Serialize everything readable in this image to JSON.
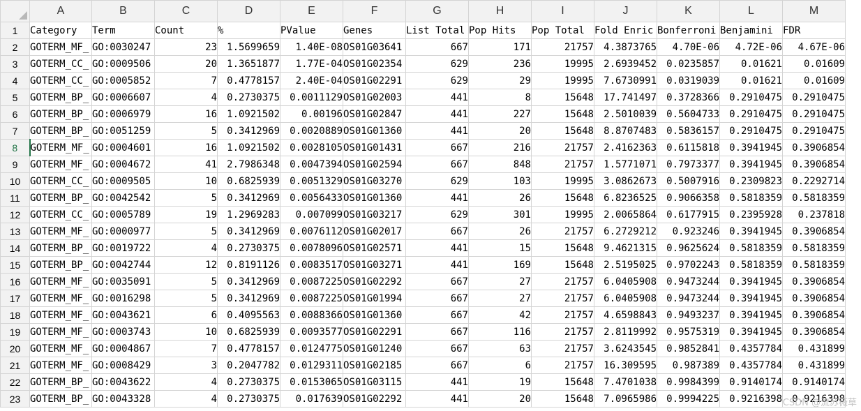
{
  "columns": [
    "A",
    "B",
    "C",
    "D",
    "E",
    "F",
    "G",
    "H",
    "I",
    "J",
    "K",
    "L",
    "M"
  ],
  "column_types": [
    "txt",
    "txt",
    "num",
    "num",
    "num",
    "txt",
    "num",
    "num",
    "num",
    "num",
    "num",
    "num",
    "num"
  ],
  "active_row": 8,
  "rows": [
    {
      "num": "1",
      "cells": [
        "Category",
        "Term",
        "Count",
        "%",
        "PValue",
        "Genes",
        "List Total",
        "Pop Hits",
        "Pop Total",
        "Fold Enric",
        "Bonferroni",
        "Benjamini",
        "FDR"
      ]
    },
    {
      "num": "2",
      "cells": [
        "GOTERM_MF_",
        "GO:0030247",
        "23",
        "1.5699659",
        "1.40E-08",
        "OS01G03641",
        "667",
        "171",
        "21757",
        "4.3873765",
        "4.70E-06",
        "4.72E-06",
        "4.67E-06"
      ]
    },
    {
      "num": "3",
      "cells": [
        "GOTERM_CC_",
        "GO:0009506",
        "20",
        "1.3651877",
        "1.77E-04",
        "OS01G02354",
        "629",
        "236",
        "19995",
        "2.6939452",
        "0.0235857",
        "0.01621",
        "0.01609"
      ]
    },
    {
      "num": "4",
      "cells": [
        "GOTERM_CC_",
        "GO:0005852",
        "7",
        "0.4778157",
        "2.40E-04",
        "OS01G02291",
        "629",
        "29",
        "19995",
        "7.6730991",
        "0.0319039",
        "0.01621",
        "0.01609"
      ]
    },
    {
      "num": "5",
      "cells": [
        "GOTERM_BP_",
        "GO:0006607",
        "4",
        "0.2730375",
        "0.0011129",
        "OS01G02003",
        "441",
        "8",
        "15648",
        "17.741497",
        "0.3728366",
        "0.2910475",
        "0.2910475"
      ]
    },
    {
      "num": "6",
      "cells": [
        "GOTERM_BP_",
        "GO:0006979",
        "16",
        "1.0921502",
        "0.00196",
        "OS01G02847",
        "441",
        "227",
        "15648",
        "2.5010039",
        "0.5604733",
        "0.2910475",
        "0.2910475"
      ]
    },
    {
      "num": "7",
      "cells": [
        "GOTERM_BP_",
        "GO:0051259",
        "5",
        "0.3412969",
        "0.0020889",
        "OS01G01360",
        "441",
        "20",
        "15648",
        "8.8707483",
        "0.5836157",
        "0.2910475",
        "0.2910475"
      ]
    },
    {
      "num": "8",
      "cells": [
        "GOTERM_MF_",
        "GO:0004601",
        "16",
        "1.0921502",
        "0.0028105",
        "OS01G01431",
        "667",
        "216",
        "21757",
        "2.4162363",
        "0.6115818",
        "0.3941945",
        "0.3906854"
      ]
    },
    {
      "num": "9",
      "cells": [
        "GOTERM_MF_",
        "GO:0004672",
        "41",
        "2.7986348",
        "0.0047394",
        "OS01G02594",
        "667",
        "848",
        "21757",
        "1.5771071",
        "0.7973377",
        "0.3941945",
        "0.3906854"
      ]
    },
    {
      "num": "10",
      "cells": [
        "GOTERM_CC_",
        "GO:0009505",
        "10",
        "0.6825939",
        "0.0051329",
        "OS01G03270",
        "629",
        "103",
        "19995",
        "3.0862673",
        "0.5007916",
        "0.2309823",
        "0.2292714"
      ]
    },
    {
      "num": "11",
      "cells": [
        "GOTERM_BP_",
        "GO:0042542",
        "5",
        "0.3412969",
        "0.0056433",
        "OS01G01360",
        "441",
        "26",
        "15648",
        "6.8236525",
        "0.9066358",
        "0.5818359",
        "0.5818359"
      ]
    },
    {
      "num": "12",
      "cells": [
        "GOTERM_CC_",
        "GO:0005789",
        "19",
        "1.2969283",
        "0.007099",
        "OS01G03217",
        "629",
        "301",
        "19995",
        "2.0065864",
        "0.6177915",
        "0.2395928",
        "0.237818"
      ]
    },
    {
      "num": "13",
      "cells": [
        "GOTERM_MF_",
        "GO:0000977",
        "5",
        "0.3412969",
        "0.0076112",
        "OS01G02017",
        "667",
        "26",
        "21757",
        "6.2729212",
        "0.923246",
        "0.3941945",
        "0.3906854"
      ]
    },
    {
      "num": "14",
      "cells": [
        "GOTERM_BP_",
        "GO:0019722",
        "4",
        "0.2730375",
        "0.0078096",
        "OS01G02571",
        "441",
        "15",
        "15648",
        "9.4621315",
        "0.9625624",
        "0.5818359",
        "0.5818359"
      ]
    },
    {
      "num": "15",
      "cells": [
        "GOTERM_BP_",
        "GO:0042744",
        "12",
        "0.8191126",
        "0.0083517",
        "OS01G03271",
        "441",
        "169",
        "15648",
        "2.5195025",
        "0.9702243",
        "0.5818359",
        "0.5818359"
      ]
    },
    {
      "num": "16",
      "cells": [
        "GOTERM_MF_",
        "GO:0035091",
        "5",
        "0.3412969",
        "0.0087225",
        "OS01G02292",
        "667",
        "27",
        "21757",
        "6.0405908",
        "0.9473244",
        "0.3941945",
        "0.3906854"
      ]
    },
    {
      "num": "17",
      "cells": [
        "GOTERM_MF_",
        "GO:0016298",
        "5",
        "0.3412969",
        "0.0087225",
        "OS01G01994",
        "667",
        "27",
        "21757",
        "6.0405908",
        "0.9473244",
        "0.3941945",
        "0.3906854"
      ]
    },
    {
      "num": "18",
      "cells": [
        "GOTERM_MF_",
        "GO:0043621",
        "6",
        "0.4095563",
        "0.0088366",
        "OS01G01360",
        "667",
        "42",
        "21757",
        "4.6598843",
        "0.9493237",
        "0.3941945",
        "0.3906854"
      ]
    },
    {
      "num": "19",
      "cells": [
        "GOTERM_MF_",
        "GO:0003743",
        "10",
        "0.6825939",
        "0.0093577",
        "OS01G02291",
        "667",
        "116",
        "21757",
        "2.8119992",
        "0.9575319",
        "0.3941945",
        "0.3906854"
      ]
    },
    {
      "num": "20",
      "cells": [
        "GOTERM_MF_",
        "GO:0004867",
        "7",
        "0.4778157",
        "0.0124775",
        "OS01G01240",
        "667",
        "63",
        "21757",
        "3.6243545",
        "0.9852841",
        "0.4357784",
        "0.431899"
      ]
    },
    {
      "num": "21",
      "cells": [
        "GOTERM_MF_",
        "GO:0008429",
        "3",
        "0.2047782",
        "0.0129311",
        "OS01G02185",
        "667",
        "6",
        "21757",
        "16.309595",
        "0.987389",
        "0.4357784",
        "0.431899"
      ]
    },
    {
      "num": "22",
      "cells": [
        "GOTERM_BP_",
        "GO:0043622",
        "4",
        "0.2730375",
        "0.0153065",
        "OS01G03115",
        "441",
        "19",
        "15648",
        "7.4701038",
        "0.9984399",
        "0.9140174",
        "0.9140174"
      ]
    },
    {
      "num": "23",
      "cells": [
        "GOTERM_BP_",
        "GO:0043328",
        "4",
        "0.2730375",
        "0.017639",
        "OS01G02292",
        "441",
        "20",
        "15648",
        "7.0965986",
        "0.9994225",
        "0.9216398",
        "0.9216398"
      ]
    }
  ],
  "watermark": "CSDN @流苏薇草"
}
